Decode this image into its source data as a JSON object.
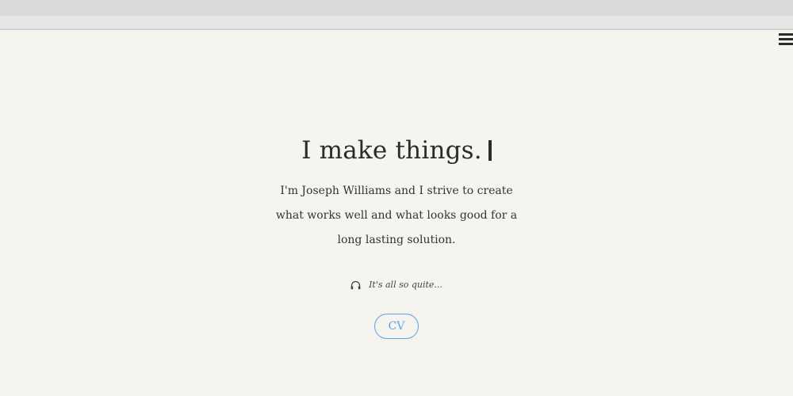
{
  "hero": {
    "headline": "I make things.",
    "intro": "I'm Joseph Williams and I strive to create what works well and what looks good for a long lasting solution.",
    "music_status": "It's all so quite...",
    "cv_label": "CV"
  },
  "icons": {
    "menu": "hamburger-menu-icon",
    "headphones": "headphones-icon"
  },
  "colors": {
    "background": "#f5f4ef",
    "accent": "#5aa2e6",
    "text": "#2b2b2b"
  }
}
